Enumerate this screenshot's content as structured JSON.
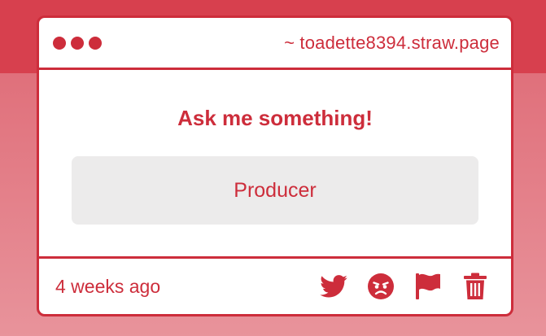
{
  "window": {
    "url": "~ toadette8394.straw.page"
  },
  "question": {
    "prompt": "Ask me something!",
    "answer": "Producer"
  },
  "footer": {
    "time": "4 weeks ago",
    "actions": [
      "twitter-icon",
      "angry-face-icon",
      "flag-icon",
      "trash-icon"
    ]
  },
  "colors": {
    "accent": "#cd2d3b",
    "background_top": "#d7404e",
    "answer_bg": "#ecebeb"
  }
}
